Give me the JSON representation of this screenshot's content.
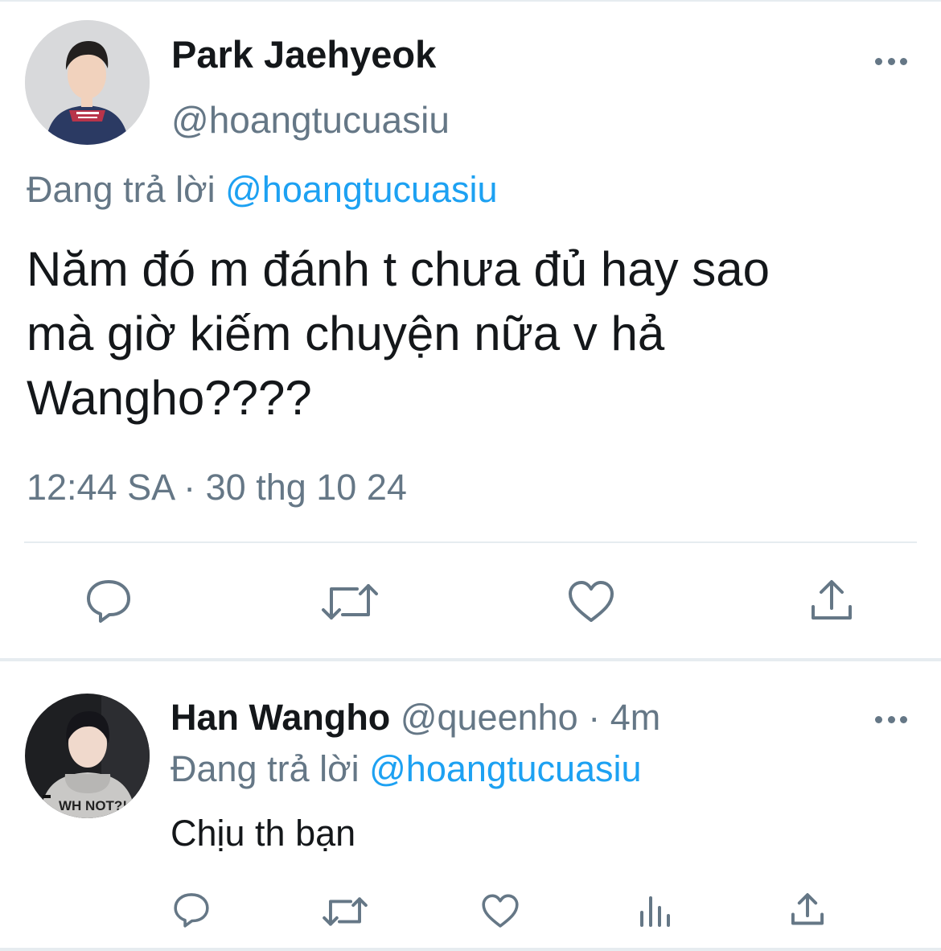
{
  "main_tweet": {
    "display_name": "Park Jaehyeok",
    "handle": "@hoangtucuasiu",
    "replying_label": "Đang trả lời",
    "replying_to": "@hoangtucuasiu",
    "text": "Năm đó m đánh t chưa đủ hay sao\nmà giờ kiếm chuyện nữa v hả\nWangho????",
    "timestamp": "12:44 SA · 30 thg 10 24",
    "actions": [
      "reply-icon",
      "retweet-icon",
      "like-icon",
      "share-icon"
    ]
  },
  "reply_tweet": {
    "display_name": "Han Wangho",
    "handle": "@queenho",
    "time_sep": "·",
    "age": "4m",
    "replying_label": "Đang trả lời",
    "replying_to": "@hoangtucuasiu",
    "text": "Chịu th bạn",
    "actions": [
      "reply-icon",
      "retweet-icon",
      "like-icon",
      "analytics-icon",
      "share-icon"
    ]
  },
  "colors": {
    "text_primary": "#14171a",
    "text_secondary": "#657786",
    "link": "#1da1f2",
    "divider": "#e6ecf0"
  }
}
